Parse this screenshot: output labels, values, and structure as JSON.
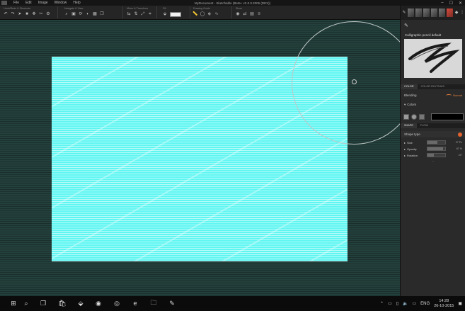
{
  "app": {
    "title": "MyDocument - Sketchable (Beta+ v3.0.0.2006 (DEX))",
    "menu": [
      "File",
      "Edit",
      "Image",
      "Window",
      "Help"
    ],
    "window_controls": [
      "–",
      "☐",
      "✕"
    ]
  },
  "toolbar": {
    "groups": [
      {
        "label": "Undo/Redo & Shortcuts",
        "icons": [
          "undo-icon",
          "redo-icon",
          "cursor-icon",
          "record-icon",
          "move-icon",
          "scissors-icon",
          "settings-icon"
        ]
      },
      {
        "label": "Navigate & View",
        "icons": [
          "zoom-icon",
          "zoom-fit-icon",
          "rotate-icon",
          "brightness-icon",
          "grid-icon",
          "layers-icon"
        ]
      },
      {
        "label": "Mirror & Transform",
        "icons": [
          "flip-h-icon",
          "flip-v-icon",
          "transform-icon",
          "crop-icon"
        ]
      },
      {
        "label": "Fill",
        "icons": [
          "fill-icon",
          "paint-bucket-icon"
        ]
      },
      {
        "label": "Drawing Guide",
        "icons": [
          "ruler-icon",
          "ellipse-icon",
          "perspective-icon",
          "lasso-icon"
        ]
      },
      {
        "label": "Show",
        "icons": [
          "eye-icon",
          "sync-icon",
          "gallery-icon",
          "menu-icon"
        ]
      }
    ]
  },
  "panel": {
    "preset_name": "Calligraphic pencil default",
    "tabs1": [
      "COLOR",
      "COLOR RHYTHMS"
    ],
    "blending_label": "Blending",
    "blending_value": "Normal",
    "colors_label": "Colors",
    "tabs2": [
      "SHAPE",
      "FLOW"
    ],
    "shape_type_label": "Shape type",
    "sliders": [
      {
        "label": "Size",
        "value_text": "27 Px",
        "fraction": 0.56
      },
      {
        "label": "Opacity",
        "value_text": "87 %",
        "fraction": 0.87
      },
      {
        "label": "Rotation",
        "value_text": "19°",
        "fraction": 0.35
      }
    ]
  },
  "canvas": {
    "color": "#5ff6f2"
  },
  "taskbar": {
    "language": "ENG",
    "time": "14:28",
    "date": "26-10-2015"
  }
}
